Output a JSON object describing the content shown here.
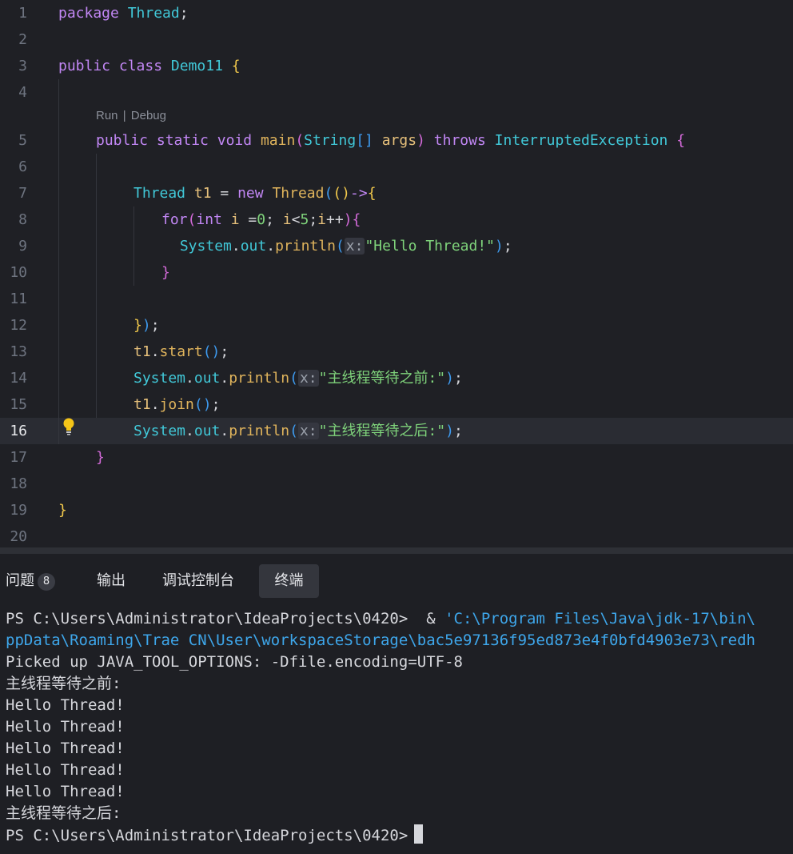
{
  "colors": {
    "editor_bg": "#1f2025",
    "keyword": "#c287f5",
    "type": "#41c8d8",
    "function": "#e0b45c",
    "string": "#7fd37b",
    "active_line": "#2a2c33",
    "terminal_path": "#3ea6ea"
  },
  "editor": {
    "codelens": {
      "run": "Run",
      "sep": "|",
      "debug": "Debug"
    },
    "lines": [
      {
        "n": "1",
        "tokens": [
          [
            "k",
            "package"
          ],
          [
            "v",
            " "
          ],
          [
            "t",
            "Thread"
          ],
          [
            "v",
            ";"
          ]
        ]
      },
      {
        "n": "2",
        "tokens": []
      },
      {
        "n": "3",
        "tokens": [
          [
            "k",
            "public"
          ],
          [
            "v",
            " "
          ],
          [
            "k",
            "class"
          ],
          [
            "v",
            " "
          ],
          [
            "t",
            "Demo11"
          ],
          [
            "v",
            " "
          ],
          [
            "b1",
            "{"
          ]
        ]
      },
      {
        "n": "4",
        "tokens": []
      },
      {
        "n": "5",
        "tokens": [
          [
            "k",
            "public"
          ],
          [
            "v",
            " "
          ],
          [
            "k",
            "static"
          ],
          [
            "v",
            " "
          ],
          [
            "k",
            "void"
          ],
          [
            "v",
            " "
          ],
          [
            "f",
            "main"
          ],
          [
            "b2",
            "("
          ],
          [
            "t",
            "String"
          ],
          [
            "b3",
            "[]"
          ],
          [
            "v",
            " "
          ],
          [
            "n",
            "args"
          ],
          [
            "b2",
            ")"
          ],
          [
            "v",
            " "
          ],
          [
            "k",
            "throws"
          ],
          [
            "v",
            " "
          ],
          [
            "t",
            "InterruptedException"
          ],
          [
            "v",
            " "
          ],
          [
            "b2",
            "{"
          ]
        ]
      },
      {
        "n": "6",
        "tokens": []
      },
      {
        "n": "7",
        "tokens": [
          [
            "t",
            "Thread"
          ],
          [
            "v",
            " "
          ],
          [
            "n",
            "t1"
          ],
          [
            "v",
            " = "
          ],
          [
            "k",
            "new"
          ],
          [
            "v",
            " "
          ],
          [
            "f",
            "Thread"
          ],
          [
            "b3",
            "("
          ],
          [
            "b1",
            "()"
          ],
          [
            "k",
            "->"
          ],
          [
            "b1",
            "{"
          ]
        ]
      },
      {
        "n": "8",
        "tokens": [
          [
            "k",
            "for"
          ],
          [
            "b2",
            "("
          ],
          [
            "k",
            "int"
          ],
          [
            "v",
            " "
          ],
          [
            "n",
            "i"
          ],
          [
            "v",
            " ="
          ],
          [
            "s",
            "0"
          ],
          [
            "v",
            "; "
          ],
          [
            "n",
            "i"
          ],
          [
            "v",
            "<"
          ],
          [
            "s",
            "5"
          ],
          [
            "v",
            ";"
          ],
          [
            "n",
            "i"
          ],
          [
            "v",
            "++"
          ],
          [
            "b2",
            ")"
          ],
          [
            "b2",
            "{"
          ]
        ]
      },
      {
        "n": "9",
        "tokens": [
          [
            "v",
            " "
          ],
          [
            "t",
            "System"
          ],
          [
            "v",
            "."
          ],
          [
            "t",
            "out"
          ],
          [
            "v",
            "."
          ],
          [
            "f",
            "println"
          ],
          [
            "b3",
            "("
          ],
          [
            "hint",
            "x:"
          ],
          [
            "s",
            "\"Hello Thread!\""
          ],
          [
            "b3",
            ")"
          ],
          [
            "v",
            ";"
          ]
        ]
      },
      {
        "n": "10",
        "tokens": [
          [
            "b2",
            "}"
          ]
        ]
      },
      {
        "n": "11",
        "tokens": []
      },
      {
        "n": "12",
        "tokens": [
          [
            "b1",
            "}"
          ],
          [
            "b3",
            ")"
          ],
          [
            "v",
            ";"
          ]
        ]
      },
      {
        "n": "13",
        "tokens": [
          [
            "n",
            "t1"
          ],
          [
            "v",
            "."
          ],
          [
            "f",
            "start"
          ],
          [
            "b3",
            "()"
          ],
          [
            "v",
            ";"
          ]
        ]
      },
      {
        "n": "14",
        "tokens": [
          [
            "t",
            "System"
          ],
          [
            "v",
            "."
          ],
          [
            "t",
            "out"
          ],
          [
            "v",
            "."
          ],
          [
            "f",
            "println"
          ],
          [
            "b3",
            "("
          ],
          [
            "hint",
            "x:"
          ],
          [
            "s",
            "\"主线程等待之前:\""
          ],
          [
            "b3",
            ")"
          ],
          [
            "v",
            ";"
          ]
        ]
      },
      {
        "n": "15",
        "tokens": [
          [
            "n",
            "t1"
          ],
          [
            "v",
            "."
          ],
          [
            "f",
            "join"
          ],
          [
            "b3",
            "()"
          ],
          [
            "v",
            ";"
          ]
        ]
      },
      {
        "n": "16",
        "tokens": [
          [
            "t",
            "System"
          ],
          [
            "v",
            "."
          ],
          [
            "t",
            "out"
          ],
          [
            "v",
            "."
          ],
          [
            "f",
            "println"
          ],
          [
            "b3",
            "("
          ],
          [
            "hint",
            "x:"
          ],
          [
            "s",
            "\"主线程等待之后:\""
          ],
          [
            "b3",
            ")"
          ],
          [
            "v",
            ";"
          ]
        ]
      },
      {
        "n": "17",
        "tokens": [
          [
            "b2",
            "}"
          ]
        ]
      },
      {
        "n": "18",
        "tokens": []
      },
      {
        "n": "19",
        "tokens": [
          [
            "b1",
            "}"
          ]
        ]
      },
      {
        "n": "20",
        "tokens": []
      }
    ]
  },
  "panel": {
    "tabs": [
      {
        "label": "问题",
        "badge": "8"
      },
      {
        "label": "输出"
      },
      {
        "label": "调试控制台"
      },
      {
        "label": "终端",
        "active": true
      }
    ],
    "terminal": {
      "prompt1": "PS C:\\Users\\Administrator\\IdeaProjects\\0420>  & ",
      "cmd1": "'C:\\Program Files\\Java\\jdk-17\\bin\\",
      "line2": "ppData\\Roaming\\Trae CN\\User\\workspaceStorage\\bac5e97136f95ed873e4f0bfd4903e73\\redh",
      "line3": "Picked up JAVA_TOOL_OPTIONS: -Dfile.encoding=UTF-8",
      "line4": "主线程等待之前:",
      "hello": [
        "Hello Thread!",
        "Hello Thread!",
        "Hello Thread!",
        "Hello Thread!",
        "Hello Thread!"
      ],
      "line10": "主线程等待之后:",
      "prompt_final": "PS C:\\Users\\Administrator\\IdeaProjects\\0420>"
    }
  }
}
